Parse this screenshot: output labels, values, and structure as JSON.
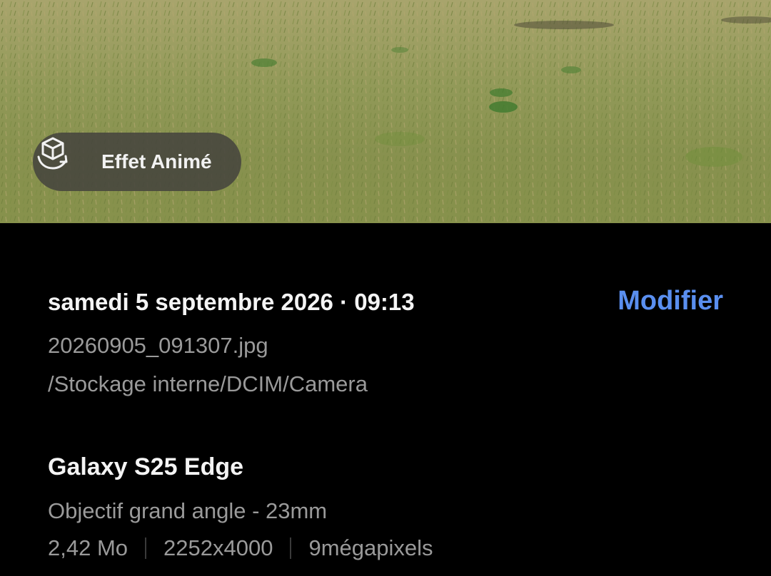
{
  "photo": {
    "alt": "photo preview",
    "effect_button": {
      "label": "Effet Animé",
      "icon": "animated-effect-cube-icon"
    }
  },
  "details": {
    "date_time": "samedi 5 septembre 2026 · 09:13",
    "edit_label": "Modifier",
    "filename": "20260905_091307.jpg",
    "path": "/Stockage interne/DCIM/Camera",
    "device": "Galaxy S25 Edge",
    "lens": "Objectif grand angle - 23mm",
    "specs": {
      "size": "2,42 Mo",
      "resolution": "2252x4000",
      "megapixels": "9mégapixels"
    }
  },
  "colors": {
    "background": "#000000",
    "accent": "#5a8ff0",
    "primary_text": "#f4f4f4",
    "secondary_text": "#9a9a9a"
  }
}
